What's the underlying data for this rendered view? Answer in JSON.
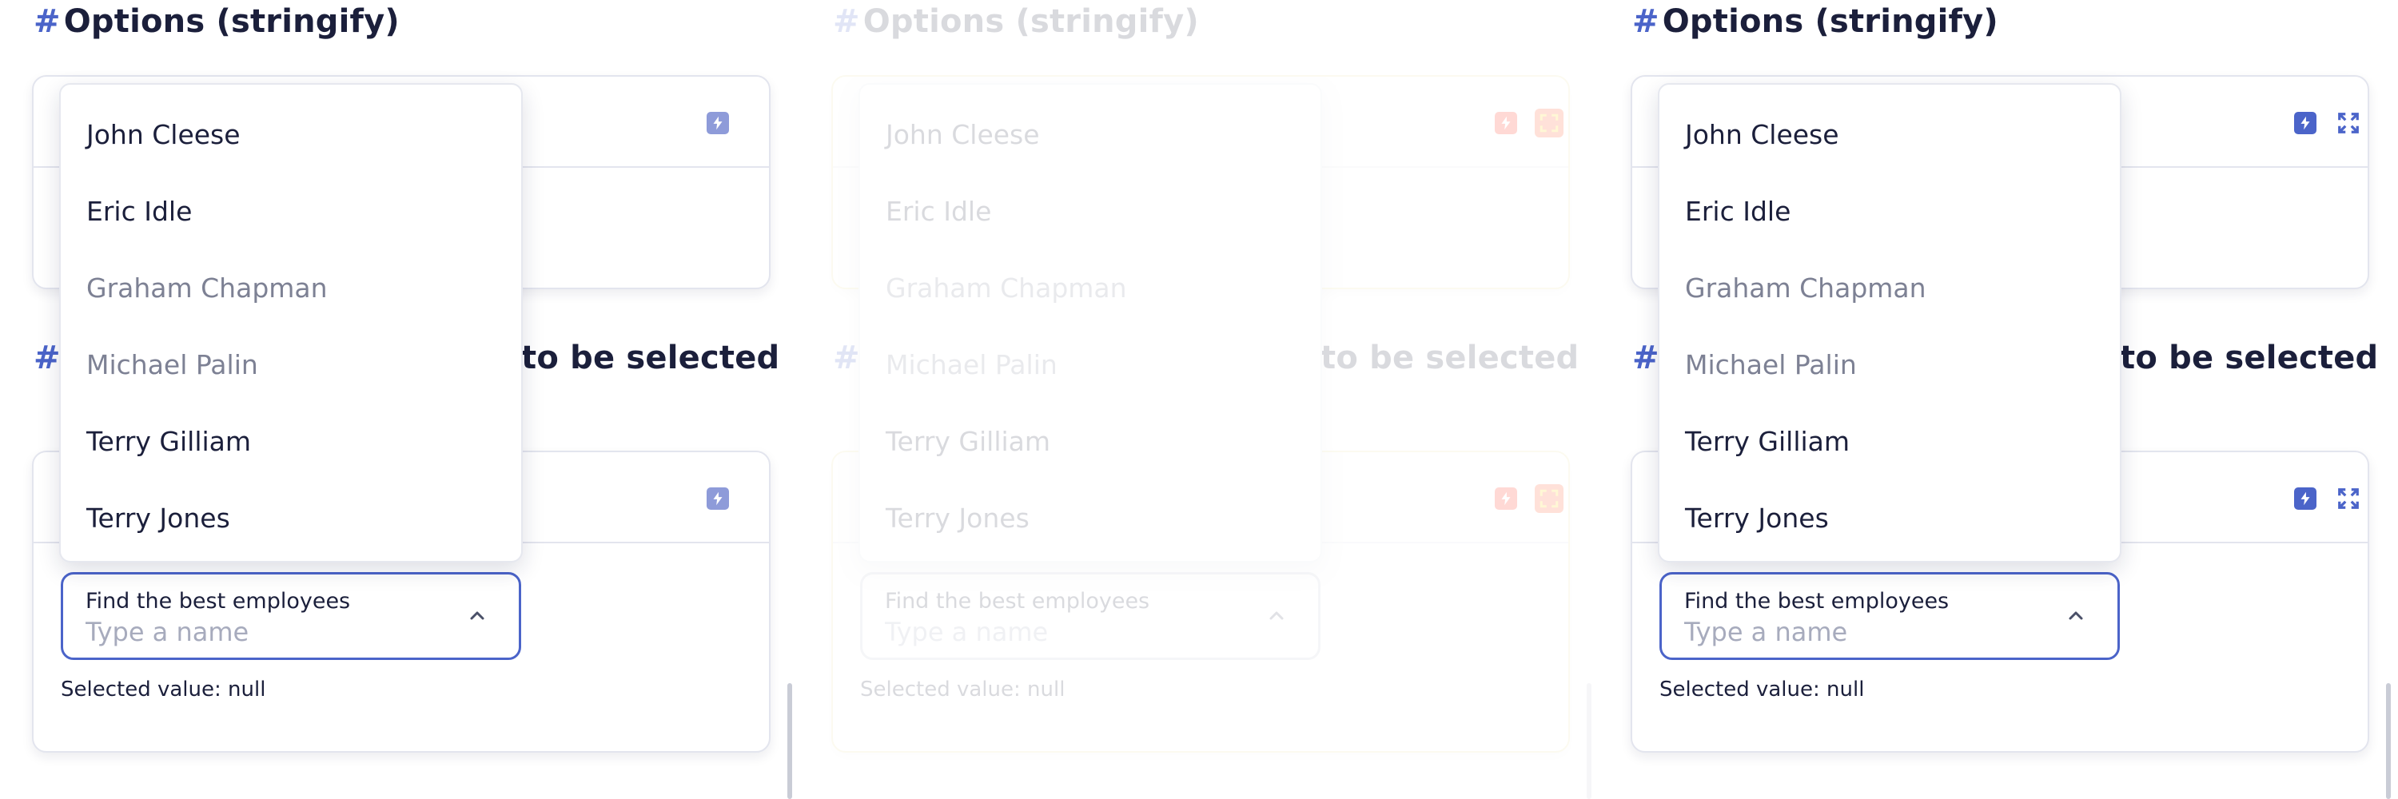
{
  "heading1": "Options (stringify)",
  "heading2_tail": "to be selected",
  "hash": "#",
  "field": {
    "label": "Find the best employees",
    "placeholder": "Type a name"
  },
  "selected_value": "Selected value: null",
  "options": [
    "John Cleese",
    "Eric Idle",
    "Graham Chapman",
    "Michael Palin",
    "Terry Gilliam",
    "Terry Jones"
  ],
  "colors": {
    "accent": "#4b64c9",
    "bolt_light": "#8e9bd9",
    "bolt_hot": "#ff1b00",
    "text_dark": "#1b1f3b",
    "text_dim": "#7d8194",
    "placeholder": "#a7abbd",
    "border": "#e3e5ee"
  },
  "icons": [
    "bolt-icon",
    "expand-icon",
    "chevron-up-icon"
  ]
}
